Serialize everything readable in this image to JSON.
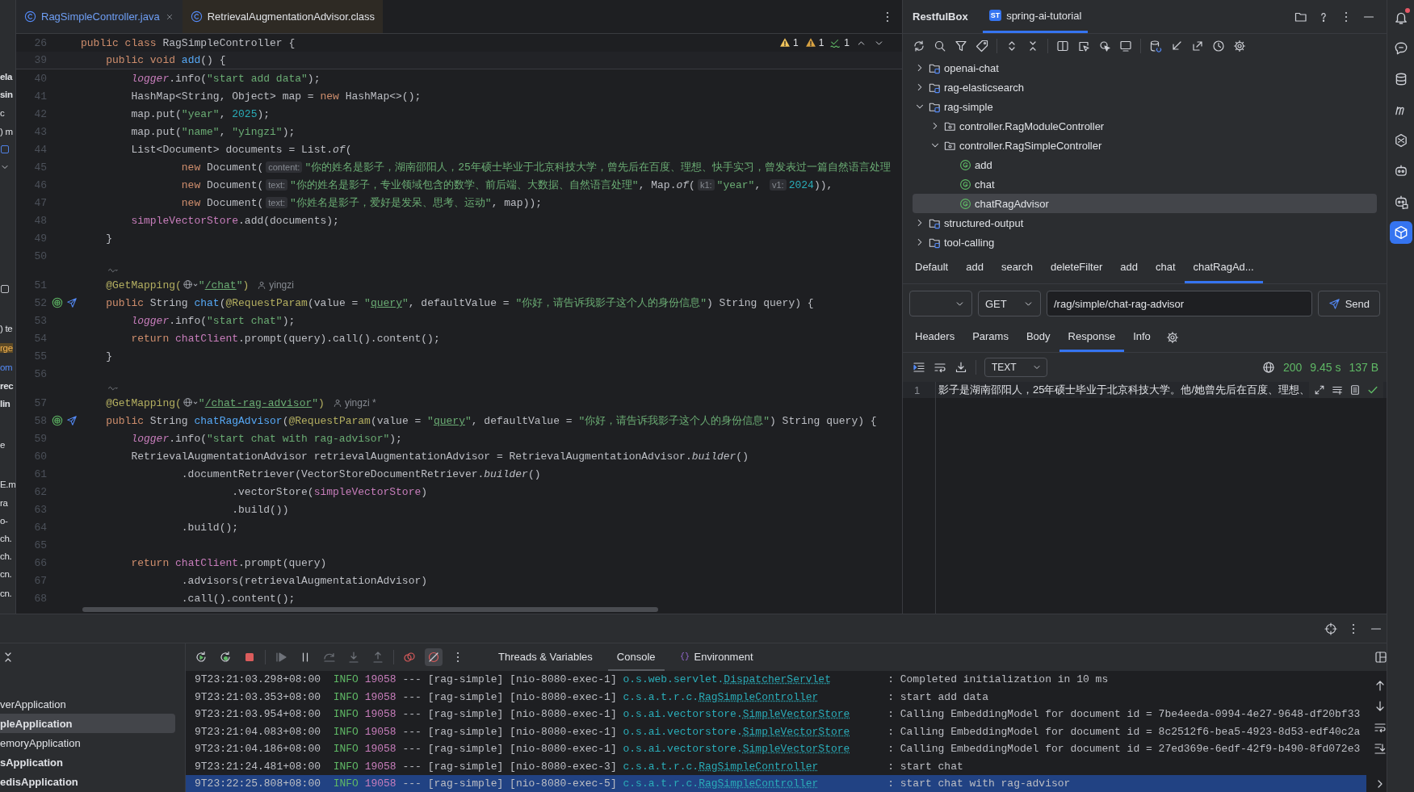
{
  "left_strip": {
    "items": [
      {
        "text": "ela",
        "kind": "bold"
      },
      {
        "text": "sin",
        "kind": "bold"
      },
      {
        "text": "c",
        "kind": "plain"
      },
      {
        "text": ") m",
        "kind": "plain"
      },
      {
        "kind": "file-icon"
      },
      {
        "kind": "chevron"
      },
      {
        "kind": "square"
      },
      {
        "text": ") te",
        "kind": "plain"
      },
      {
        "text": "rge",
        "kind": "highlight"
      },
      {
        "text": "om",
        "kind": "link"
      },
      {
        "text": "rec",
        "kind": "bold"
      },
      {
        "text": "lin",
        "kind": "bold"
      },
      {
        "text": "e",
        "kind": "plain"
      },
      {
        "text": "E.m",
        "kind": "plain"
      },
      {
        "text": "ra",
        "kind": "plain"
      },
      {
        "text": "o-",
        "kind": "plain"
      },
      {
        "text": "ch.",
        "kind": "plain"
      },
      {
        "text": "ch.",
        "kind": "plain"
      },
      {
        "text": "cn.",
        "kind": "plain"
      },
      {
        "text": "cn.",
        "kind": "plain"
      }
    ]
  },
  "editor": {
    "tabs": [
      {
        "label": "RagSimpleController.java",
        "kind": "source",
        "selected": true,
        "closable": true
      },
      {
        "label": "RetrievalAugmentationAdvisor.class",
        "kind": "library",
        "selected": false,
        "closable": false
      }
    ],
    "problems": [
      {
        "kind": "warning",
        "count": "1"
      },
      {
        "kind": "weak-warning",
        "count": "1"
      },
      {
        "kind": "typo",
        "count": "1"
      }
    ],
    "lines": [
      {
        "kind": "code",
        "number": "26",
        "tokens": [
          {
            "text": "public class",
            "kind": "keyword"
          },
          {
            "text": " RagSimpleController {"
          }
        ]
      },
      {
        "kind": "code",
        "number": "39",
        "sticky": true,
        "tokens": [
          {
            "text": "    public void ",
            "kind": "keyword"
          },
          {
            "text": "add",
            "kind": "method"
          },
          {
            "text": "() {"
          }
        ]
      },
      {
        "kind": "code",
        "number": "40",
        "tokens": [
          {
            "text": "        logger",
            "kind": "field-italic"
          },
          {
            "text": ".info("
          },
          {
            "text": "\"start add data\"",
            "kind": "string"
          },
          {
            "text": ");"
          }
        ]
      },
      {
        "kind": "code",
        "number": "41",
        "tokens": [
          {
            "text": "        HashMap<String, Object> map = "
          },
          {
            "text": "new",
            "kind": "keyword"
          },
          {
            "text": " HashMap<>();"
          }
        ]
      },
      {
        "kind": "code",
        "number": "42",
        "tokens": [
          {
            "text": "        map.put("
          },
          {
            "text": "\"year\"",
            "kind": "string"
          },
          {
            "text": ", "
          },
          {
            "text": "2025",
            "kind": "number"
          },
          {
            "text": ");"
          }
        ]
      },
      {
        "kind": "code",
        "number": "43",
        "tokens": [
          {
            "text": "        map.put("
          },
          {
            "text": "\"name\"",
            "kind": "string"
          },
          {
            "text": ", "
          },
          {
            "text": "\"yingzi\"",
            "kind": "string"
          },
          {
            "text": ");"
          }
        ]
      },
      {
        "kind": "code",
        "number": "44",
        "tokens": [
          {
            "text": "        List<Document> documents = List."
          },
          {
            "text": "of",
            "kind": "italic"
          },
          {
            "text": "("
          }
        ]
      },
      {
        "kind": "code",
        "number": "45",
        "tokens": [
          {
            "text": "                new",
            "kind": "keyword"
          },
          {
            "text": " Document("
          },
          {
            "text": "content:",
            "kind": "hint"
          },
          {
            "text": "\"你的姓名是影子，湖南邵阳人，25年硕士毕业于北京科技大学，曾先后在百度、理想、快手实习，曾发表过一篇自然语言处理",
            "kind": "string"
          }
        ]
      },
      {
        "kind": "code",
        "number": "46",
        "tokens": [
          {
            "text": "                new",
            "kind": "keyword"
          },
          {
            "text": " Document("
          },
          {
            "text": "text:",
            "kind": "hint"
          },
          {
            "text": "\"你的姓名是影子，专业领域包含的数学、前后端、大数据、自然语言处理\"",
            "kind": "string"
          },
          {
            "text": ", Map."
          },
          {
            "text": "of",
            "kind": "italic"
          },
          {
            "text": "("
          },
          {
            "text": "k1:",
            "kind": "hint"
          },
          {
            "text": "\"year\"",
            "kind": "string"
          },
          {
            "text": ", "
          },
          {
            "text": "v1:",
            "kind": "hint"
          },
          {
            "text": "2024",
            "kind": "number"
          },
          {
            "text": ")),"
          }
        ]
      },
      {
        "kind": "code",
        "number": "47",
        "tokens": [
          {
            "text": "                new",
            "kind": "keyword"
          },
          {
            "text": " Document("
          },
          {
            "text": "text:",
            "kind": "hint"
          },
          {
            "text": "\"你姓名是影子，爱好是发呆、思考、运动\"",
            "kind": "string"
          },
          {
            "text": ", map));"
          }
        ]
      },
      {
        "kind": "code",
        "number": "48",
        "tokens": [
          {
            "text": "        simpleVectorStore",
            "kind": "field"
          },
          {
            "text": ".add(documents);"
          }
        ]
      },
      {
        "kind": "code",
        "number": "49",
        "tokens": [
          {
            "text": "    }"
          }
        ]
      },
      {
        "kind": "code",
        "number": "50"
      },
      {
        "kind": "inlay"
      },
      {
        "kind": "code",
        "number": "51",
        "tokens": [
          {
            "text": "    @GetMapping(",
            "kind": "annotation"
          },
          {
            "kind": "globe"
          },
          {
            "text": "\"",
            "kind": "string"
          },
          {
            "text": "/chat",
            "kind": "link"
          },
          {
            "text": "\"",
            "kind": "string"
          },
          {
            "text": ")",
            "kind": "annotation"
          },
          {
            "text": "yingzi",
            "kind": "author"
          }
        ]
      },
      {
        "kind": "code",
        "number": "52",
        "run_marker": true,
        "tokens": [
          {
            "text": "    public",
            "kind": "keyword"
          },
          {
            "text": " String "
          },
          {
            "text": "chat",
            "kind": "method"
          },
          {
            "text": "("
          },
          {
            "text": "@RequestParam",
            "kind": "annotation"
          },
          {
            "text": "(value = "
          },
          {
            "text": "\"",
            "kind": "string"
          },
          {
            "text": "query",
            "kind": "link"
          },
          {
            "text": "\"",
            "kind": "string"
          },
          {
            "text": ", defaultValue = "
          },
          {
            "text": "\"你好，请告诉我影子这个人的身份信息\"",
            "kind": "string"
          },
          {
            "text": ") String query) {"
          }
        ]
      },
      {
        "kind": "code",
        "number": "53",
        "tokens": [
          {
            "text": "        logger",
            "kind": "field-italic"
          },
          {
            "text": ".info("
          },
          {
            "text": "\"start chat\"",
            "kind": "string"
          },
          {
            "text": ");"
          }
        ]
      },
      {
        "kind": "code",
        "number": "54",
        "tokens": [
          {
            "text": "        return ",
            "kind": "keyword"
          },
          {
            "text": "chatClient",
            "kind": "field"
          },
          {
            "text": ".prompt(query).call().content();"
          }
        ]
      },
      {
        "kind": "code",
        "number": "55",
        "tokens": [
          {
            "text": "    }"
          }
        ]
      },
      {
        "kind": "code",
        "number": "56"
      },
      {
        "kind": "inlay"
      },
      {
        "kind": "code",
        "number": "57",
        "tokens": [
          {
            "text": "    @GetMapping(",
            "kind": "annotation"
          },
          {
            "kind": "globe"
          },
          {
            "text": "\"",
            "kind": "string"
          },
          {
            "text": "/chat-rag-advisor",
            "kind": "link"
          },
          {
            "text": "\"",
            "kind": "string"
          },
          {
            "text": ")",
            "kind": "annotation"
          },
          {
            "text": "yingzi *",
            "kind": "author"
          }
        ]
      },
      {
        "kind": "code",
        "number": "58",
        "run_marker": true,
        "tokens": [
          {
            "text": "    public",
            "kind": "keyword"
          },
          {
            "text": " String "
          },
          {
            "text": "chatRagAdvisor",
            "kind": "method"
          },
          {
            "text": "("
          },
          {
            "text": "@RequestParam",
            "kind": "annotation"
          },
          {
            "text": "(value = "
          },
          {
            "text": "\"",
            "kind": "string"
          },
          {
            "text": "query",
            "kind": "link"
          },
          {
            "text": "\"",
            "kind": "string"
          },
          {
            "text": ", defaultValue = "
          },
          {
            "text": "\"你好，请告诉我影子这个人的身份信息\"",
            "kind": "string"
          },
          {
            "text": ") String query) {"
          }
        ]
      },
      {
        "kind": "code",
        "number": "59",
        "tokens": [
          {
            "text": "        logger",
            "kind": "field-italic"
          },
          {
            "text": ".info("
          },
          {
            "text": "\"start chat with rag-advisor\"",
            "kind": "string"
          },
          {
            "text": ");"
          }
        ]
      },
      {
        "kind": "code",
        "number": "60",
        "tokens": [
          {
            "text": "        RetrievalAugmentationAdvisor retrievalAugmentationAdvisor = RetrievalAugmentationAdvisor."
          },
          {
            "text": "builder",
            "kind": "italic"
          },
          {
            "text": "()"
          }
        ]
      },
      {
        "kind": "code",
        "number": "61",
        "tokens": [
          {
            "text": "                .documentRetriever(VectorStoreDocumentRetriever."
          },
          {
            "text": "builder",
            "kind": "italic"
          },
          {
            "text": "()"
          }
        ]
      },
      {
        "kind": "code",
        "number": "62",
        "tokens": [
          {
            "text": "                        .vectorStore("
          },
          {
            "text": "simpleVectorStore",
            "kind": "field"
          },
          {
            "text": ")"
          }
        ]
      },
      {
        "kind": "code",
        "number": "63",
        "tokens": [
          {
            "text": "                        .build())"
          }
        ]
      },
      {
        "kind": "code",
        "number": "64",
        "tokens": [
          {
            "text": "                .build();"
          }
        ]
      },
      {
        "kind": "code",
        "number": "65"
      },
      {
        "kind": "code",
        "number": "66",
        "tokens": [
          {
            "text": "        return ",
            "kind": "keyword"
          },
          {
            "text": "chatClient",
            "kind": "field"
          },
          {
            "text": ".prompt(query)"
          }
        ]
      },
      {
        "kind": "code",
        "number": "67",
        "tokens": [
          {
            "text": "                .advisors(retrievalAugmentationAdvisor)"
          }
        ]
      },
      {
        "kind": "code",
        "number": "68",
        "tokens": [
          {
            "text": "                .call().content();"
          }
        ]
      }
    ]
  },
  "rest": {
    "title": "RestfulBox",
    "project_tab": {
      "badge": "ST",
      "label": "spring-ai-tutorial",
      "selected": true
    },
    "tree": [
      {
        "label": "openai-chat",
        "kind": "module",
        "expanded": false,
        "selected": false
      },
      {
        "label": "rag-elasticsearch",
        "kind": "module",
        "expanded": false,
        "selected": false
      },
      {
        "label": "rag-simple",
        "kind": "module",
        "expanded": true,
        "selected": false,
        "children": [
          {
            "label": "controller.RagModuleController",
            "kind": "controller",
            "expanded": false,
            "selected": false
          },
          {
            "label": "controller.RagSimpleController",
            "kind": "controller",
            "expanded": true,
            "selected": false,
            "children": [
              {
                "label": "add",
                "kind": "endpoint",
                "selected": false
              },
              {
                "label": "chat",
                "kind": "endpoint",
                "selected": false
              },
              {
                "label": "chatRagAdvisor",
                "kind": "endpoint",
                "selected": true
              }
            ]
          }
        ]
      },
      {
        "label": "structured-output",
        "kind": "module",
        "expanded": false,
        "selected": false
      },
      {
        "label": "tool-calling",
        "kind": "module",
        "expanded": false,
        "selected": false
      }
    ],
    "request_tabs": [
      {
        "label": "Default",
        "selected": false
      },
      {
        "label": "add",
        "selected": false
      },
      {
        "label": "search",
        "selected": false
      },
      {
        "label": "deleteFilter",
        "selected": false
      },
      {
        "label": "add",
        "selected": false
      },
      {
        "label": "chat",
        "selected": false
      },
      {
        "label": "chatRagAd...",
        "selected": true
      }
    ],
    "request": {
      "method": "GET",
      "url": "/rag/simple/chat-rag-advisor",
      "send": "Send"
    },
    "response_tabs": [
      {
        "label": "Headers",
        "selected": false
      },
      {
        "label": "Params",
        "selected": false
      },
      {
        "label": "Body",
        "selected": false
      },
      {
        "label": "Response",
        "selected": true
      },
      {
        "label": "Info",
        "selected": false
      }
    ],
    "response": {
      "format": "TEXT",
      "status": "200",
      "time": "9.45 s",
      "size": "137 B",
      "lines": [
        {
          "number": "1",
          "text": "影子是湖南邵阳人，25年硕士毕业于北京科技大学。他/她曾先后在百度、理想、"
        }
      ]
    }
  },
  "tool_strip": [
    {
      "kind": "notifications",
      "unread": true,
      "selected": false
    },
    {
      "kind": "assistant",
      "selected": false
    },
    {
      "kind": "database",
      "selected": false
    },
    {
      "kind": "arches",
      "selected": false
    },
    {
      "kind": "hexagon",
      "selected": false
    },
    {
      "kind": "robot",
      "selected": false
    },
    {
      "kind": "robot-chat",
      "selected": false
    },
    {
      "kind": "restful",
      "selected": true
    }
  ],
  "debug": {
    "mute_breakpoints": true,
    "tabs": [
      {
        "label": "Threads & Variables",
        "kind": "threads",
        "selected": false
      },
      {
        "label": "Console",
        "kind": "console",
        "selected": true
      },
      {
        "label": "Environment",
        "kind": "environment",
        "selected": false
      }
    ],
    "run_configs": [
      {
        "label": "verApplication",
        "running": false,
        "selected": false
      },
      {
        "label": "pleApplication",
        "running": true,
        "selected": true
      },
      {
        "label": "emoryApplication",
        "running": false,
        "selected": false
      },
      {
        "label": "sApplication",
        "running": true,
        "selected": false
      },
      {
        "label": "edisApplication",
        "running": true,
        "selected": false
      }
    ],
    "console": [
      {
        "time": "9T23:21:03.298+08:00",
        "level": "INFO",
        "pid": "19058",
        "sep": "---",
        "app": "[rag-simple]",
        "thread": "[nio-8080-exec-1]",
        "logger_package": "o.s.web.servlet.",
        "logger_class": "DispatcherServlet",
        "message": ": Completed initialization in 10 ms",
        "selected": false
      },
      {
        "time": "9T23:21:03.353+08:00",
        "level": "INFO",
        "pid": "19058",
        "sep": "---",
        "app": "[rag-simple]",
        "thread": "[nio-8080-exec-1]",
        "logger_package": "c.s.a.t.r.c.",
        "logger_class": "RagSimpleController",
        "message": ": start add data",
        "selected": false
      },
      {
        "time": "9T23:21:03.954+08:00",
        "level": "INFO",
        "pid": "19058",
        "sep": "---",
        "app": "[rag-simple]",
        "thread": "[nio-8080-exec-1]",
        "logger_package": "o.s.ai.vectorstore.",
        "logger_class": "SimpleVectorStore",
        "message": ": Calling EmbeddingModel for document id = 7be4eeda-0994-4e27-9648-df20bf33",
        "selected": false
      },
      {
        "time": "9T23:21:04.083+08:00",
        "level": "INFO",
        "pid": "19058",
        "sep": "---",
        "app": "[rag-simple]",
        "thread": "[nio-8080-exec-1]",
        "logger_package": "o.s.ai.vectorstore.",
        "logger_class": "SimpleVectorStore",
        "message": ": Calling EmbeddingModel for document id = 8c2512f6-bea5-4923-8d53-edf40c2a",
        "selected": false
      },
      {
        "time": "9T23:21:04.186+08:00",
        "level": "INFO",
        "pid": "19058",
        "sep": "---",
        "app": "[rag-simple]",
        "thread": "[nio-8080-exec-1]",
        "logger_package": "o.s.ai.vectorstore.",
        "logger_class": "SimpleVectorStore",
        "message": ": Calling EmbeddingModel for document id = 27ed369e-6edf-42f9-b490-8fd072e3",
        "selected": false
      },
      {
        "time": "9T23:21:24.481+08:00",
        "level": "INFO",
        "pid": "19058",
        "sep": "---",
        "app": "[rag-simple]",
        "thread": "[nio-8080-exec-3]",
        "logger_package": "c.s.a.t.r.c.",
        "logger_class": "RagSimpleController",
        "message": ": start chat",
        "selected": false
      },
      {
        "time": "9T23:22:25.808+08:00",
        "level": "INFO",
        "pid": "19058",
        "sep": "---",
        "app": "[rag-simple]",
        "thread": "[nio-8080-exec-5]",
        "logger_package": "c.s.a.t.r.c.",
        "logger_class": "RagSimpleController",
        "message": ": start chat with rag-advisor",
        "selected": true
      }
    ]
  }
}
